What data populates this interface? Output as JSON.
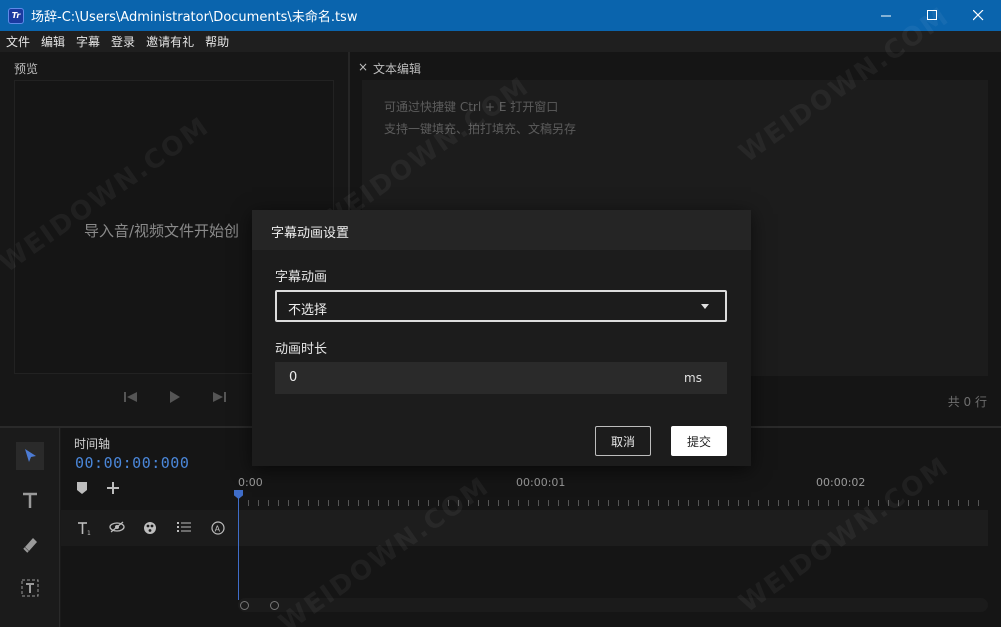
{
  "window": {
    "title": "场辞-C:\\Users\\Administrator\\Documents\\未命名.tsw",
    "app_icon_text": "Tr",
    "minimize_icon": "minimize-icon",
    "maximize_icon": "maximize-icon",
    "close_icon": "close-icon"
  },
  "menu": [
    "文件",
    "编辑",
    "字幕",
    "登录",
    "邀请有礼",
    "帮助"
  ],
  "preview": {
    "label": "预览",
    "placeholder": "导入音/视频文件开始创"
  },
  "text_editor": {
    "close_glyph": "×",
    "label": "文本编辑",
    "hints": [
      "可通过快捷键 Ctrl + E 打开窗口",
      "支持一键填充、拍打填充、文稿另存"
    ],
    "line_count": "共 0 行"
  },
  "timeline": {
    "title": "时间轴",
    "timecode": "00:00:00:000",
    "ruler_labels": [
      "0:00",
      "00:00:01",
      "00:00:02"
    ]
  },
  "dialog": {
    "title": "字幕动画设置",
    "animation_label": "字幕动画",
    "animation_value": "不选择",
    "duration_label": "动画时长",
    "duration_value": "0",
    "duration_unit": "ms",
    "cancel_label": "取消",
    "submit_label": "提交"
  },
  "watermark_text": "WEIDOWN.COM",
  "colors": {
    "titlebar": "#0a64ad",
    "accent": "#4a86d8",
    "background": "#1a1a1a"
  }
}
